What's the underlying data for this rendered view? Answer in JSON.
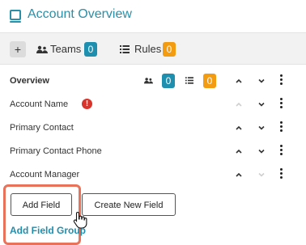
{
  "header": {
    "title": "Account Overview",
    "icon": "form-icon"
  },
  "toolbar": {
    "add_label": "+",
    "teams_label": "Teams",
    "teams_count": "0",
    "rules_label": "Rules",
    "rules_count": "0",
    "colors": {
      "teams_badge": "#1f8fb0",
      "rules_badge": "#f39c12"
    }
  },
  "group": {
    "label": "Overview",
    "teams_count": "0",
    "rules_count": "0"
  },
  "fields": [
    {
      "label": "Account Name",
      "error": "!"
    },
    {
      "label": "Primary Contact"
    },
    {
      "label": "Primary Contact Phone"
    },
    {
      "label": "Account Manager"
    }
  ],
  "buttons": {
    "add_field": "Add Field",
    "create_new_field": "Create New Field"
  },
  "footer": {
    "add_field_group": "Add Field Group"
  },
  "colors": {
    "accent": "#2b8fa7",
    "error": "#d9342b",
    "highlight": "#e8735a"
  }
}
